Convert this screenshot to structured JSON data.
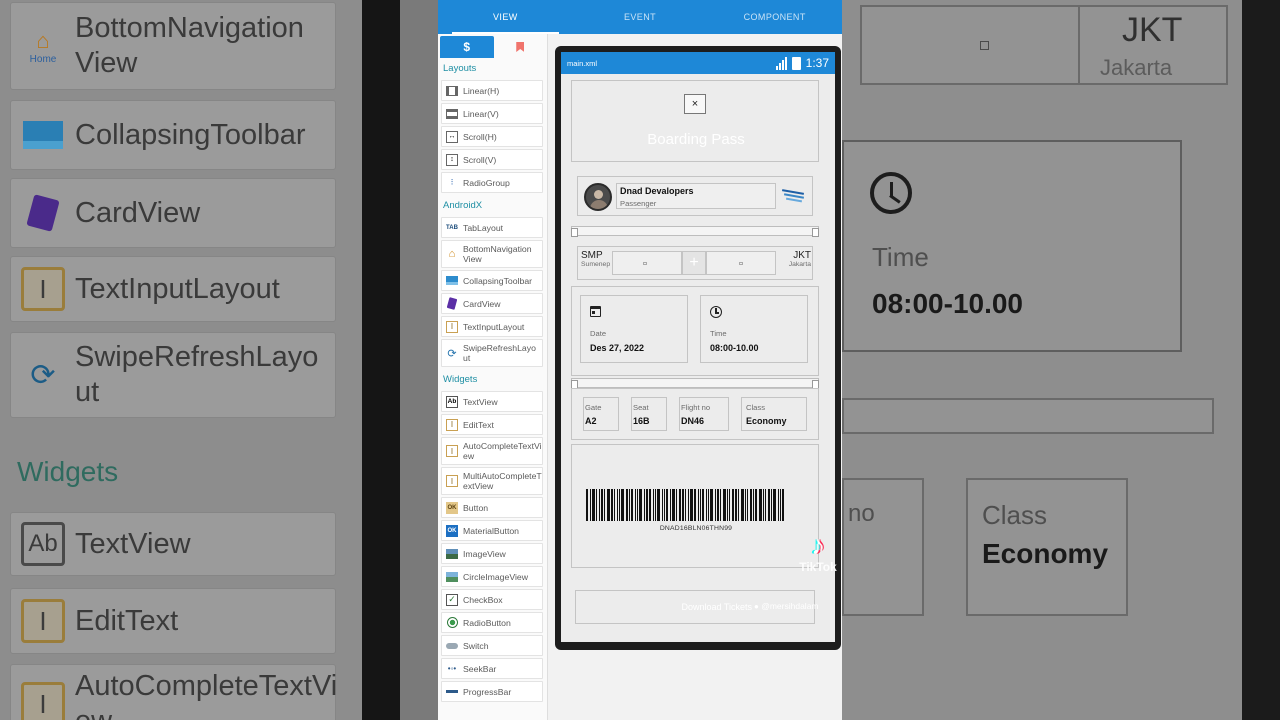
{
  "background_left": {
    "items": [
      {
        "label": "BottomNavigation View",
        "icon": "home-icon",
        "icon_label": "Home"
      },
      {
        "label": "CollapsingToolbar",
        "icon": "toolbar-icon"
      },
      {
        "label": "CardView",
        "icon": "card-icon"
      },
      {
        "label": "TextInputLayout",
        "icon": "text-input-icon"
      },
      {
        "label": "SwipeRefreshLayo ut",
        "icon": "refresh-icon"
      },
      {
        "label": "TextView",
        "icon": "textview-icon"
      },
      {
        "label": "EditText",
        "icon": "edittext-icon"
      },
      {
        "label": "AutoCompleteTextVi ew",
        "icon": "autocomplete-icon"
      }
    ],
    "section": "Widgets"
  },
  "background_right": {
    "code": "JKT",
    "city": "Jakarta",
    "time_label": "Time",
    "time_value": "08:00-10.00",
    "no_partial": "no",
    "class_label": "Class",
    "class_value": "Economy"
  },
  "top_tabs": [
    {
      "label": "VIEW"
    },
    {
      "label": "EVENT"
    },
    {
      "label": "COMPONENT"
    }
  ],
  "palette": {
    "tab_icons": [
      "dollar-icon",
      "bookmark-icon"
    ],
    "tab_glyphs": [
      "$",
      "🔖"
    ],
    "sections": {
      "layouts": "Layouts",
      "androidx": "AndroidX",
      "widgets": "Widgets"
    },
    "layouts": [
      "Linear(H)",
      "Linear(V)",
      "Scroll(H)",
      "Scroll(V)",
      "RadioGroup"
    ],
    "androidx": [
      "TabLayout",
      "BottomNavigation View",
      "CollapsingToolbar",
      "CardView",
      "TextInputLayout",
      "SwipeRefreshLayo ut"
    ],
    "widgets": [
      "TextView",
      "EditText",
      "AutoCompleteTextVi ew",
      "MultiAutoCompleteT extView",
      "Button",
      "MaterialButton",
      "ImageView",
      "CircleImageView",
      "CheckBox",
      "RadioButton",
      "Switch",
      "SeekBar",
      "ProgressBar"
    ]
  },
  "device": {
    "file_name": "main.xml",
    "clock": "1:37",
    "close_glyph": "×",
    "title": "Boarding Pass",
    "passenger": {
      "name": "Dnad Devalopers",
      "role": "Passenger"
    },
    "route": {
      "from_code": "SMP",
      "from_city": "Sumenep",
      "plus": "+",
      "to_code": "JKT",
      "to_city": "Jakarta"
    },
    "date": {
      "label": "Date",
      "value": "Des 27, 2022"
    },
    "time": {
      "label": "Time",
      "value": "08:00-10.00"
    },
    "gate": {
      "label": "Gate",
      "value": "A2"
    },
    "seat": {
      "label": "Seat",
      "value": "16B"
    },
    "flight": {
      "label": "Flight no",
      "value": "DN46"
    },
    "class": {
      "label": "Class",
      "value": "Economy"
    },
    "barcode_text": "DNAD16BLN06THN99",
    "download_label": "Download Tickets",
    "watermark_handle": "@mersihdalam"
  },
  "watermark": {
    "brand": "TikTok",
    "glyph": "♪"
  },
  "colors": {
    "accent": "#1e88d7",
    "section_text": "#1f8fa4"
  }
}
